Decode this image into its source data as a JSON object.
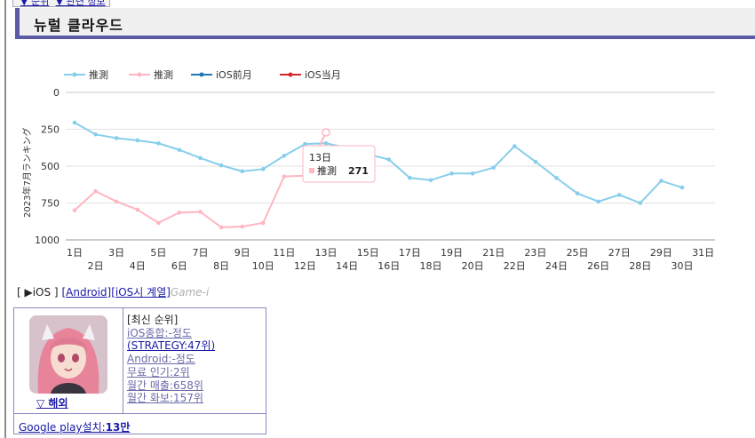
{
  "header": {
    "title": "뉴럴 클라우드"
  },
  "top_tabs": [
    "▼ 순위",
    "▼ 관련 정보"
  ],
  "chart_data": {
    "type": "line",
    "ylabel": "2023年7月ランキング",
    "ylim": [
      0,
      1000
    ],
    "y_reversed": true,
    "yticks": [
      0,
      250,
      500,
      750,
      1000
    ],
    "x": [
      1,
      2,
      3,
      4,
      5,
      6,
      7,
      8,
      9,
      10,
      11,
      12,
      13,
      14,
      15,
      16,
      17,
      18,
      19,
      20,
      21,
      22,
      23,
      24,
      25,
      26,
      27,
      28,
      29,
      30
    ],
    "xtick_labels": [
      "1日",
      "2日",
      "3日",
      "4日",
      "5日",
      "6日",
      "7日",
      "8日",
      "9日",
      "10日",
      "11日",
      "12日",
      "13日",
      "14日",
      "15日",
      "16日",
      "17日",
      "18日",
      "19日",
      "20日",
      "21日",
      "22日",
      "23日",
      "24日",
      "25日",
      "26日",
      "27日",
      "28日",
      "29日",
      "30日",
      "31日"
    ],
    "grid": true,
    "legend_position": "top-left",
    "series": [
      {
        "name": "推測",
        "color": "#87ceeb",
        "values": [
          205,
          285,
          310,
          325,
          345,
          390,
          445,
          495,
          535,
          520,
          430,
          350,
          345,
          375,
          420,
          455,
          580,
          595,
          550,
          550,
          510,
          365,
          470,
          580,
          685,
          740,
          695,
          750,
          600,
          645
        ]
      },
      {
        "name": "推測",
        "color": "#ffb6c1",
        "values": [
          800,
          670,
          740,
          795,
          885,
          815,
          810,
          915,
          910,
          885,
          570,
          565,
          271,
          null,
          null,
          null,
          null,
          null,
          null,
          null,
          null,
          null,
          null,
          null,
          null,
          null,
          null,
          null,
          null,
          null
        ]
      },
      {
        "name": "iOS前月",
        "color": "#1f77b4",
        "values": []
      },
      {
        "name": "iOS当月",
        "color": "#d62728",
        "values": []
      }
    ],
    "tooltip": {
      "title": "13日",
      "series": "推測",
      "value": "271"
    }
  },
  "platforms": {
    "open": "[ ▶iOS ]",
    "android": "[Android]",
    "ios_series": "[iOS시 계열]",
    "game_i": "Game-i"
  },
  "card": {
    "region": "▽ 해외",
    "heading": "[최신 순위]",
    "ios_total": "iOS종합:-정도",
    "strategy": "(STRATEGY:47위)",
    "android": "Android:-정도",
    "free_popular": "무료 인기:2위",
    "monthly_sales": "월간 매출:658위",
    "monthly_topic": "월간 화보:157위",
    "google_play_label": "Google play설치:",
    "google_play_value": "13만"
  }
}
